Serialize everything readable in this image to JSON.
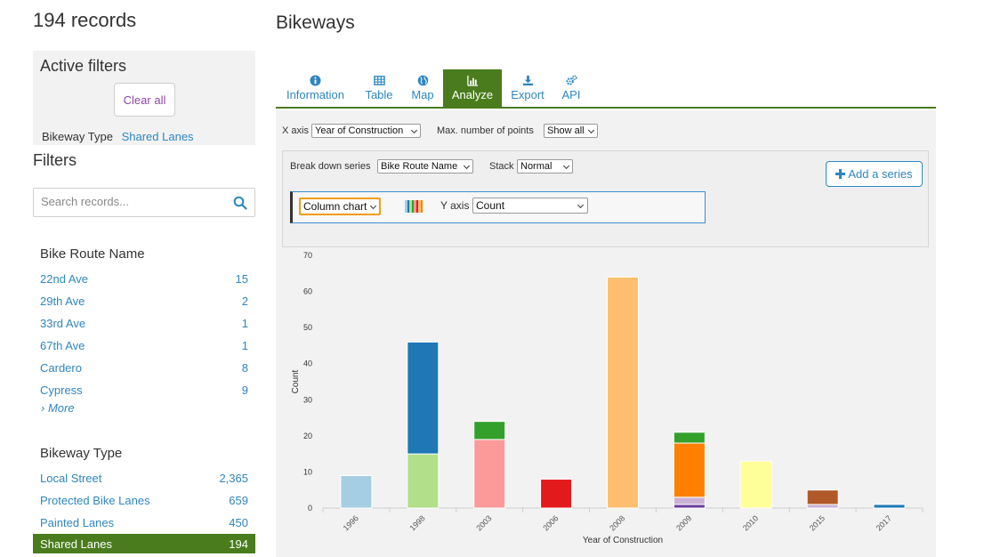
{
  "sidebar": {
    "records_count": "194 records",
    "active_filters": {
      "title": "Active filters",
      "clear_label": "Clear all",
      "filter_key": "Bikeway Type",
      "filter_value": "Shared Lanes"
    },
    "filters_title": "Filters",
    "search_placeholder": "Search records...",
    "bike_route": {
      "title": "Bike Route Name",
      "items": [
        {
          "label": "22nd Ave",
          "count": "15"
        },
        {
          "label": "29th Ave",
          "count": "2"
        },
        {
          "label": "33rd Ave",
          "count": "1"
        },
        {
          "label": "67th Ave",
          "count": "1"
        },
        {
          "label": "Cardero",
          "count": "8"
        },
        {
          "label": "Cypress",
          "count": "9"
        }
      ],
      "more_label": "› More"
    },
    "bikeway_type": {
      "title": "Bikeway Type",
      "items": [
        {
          "label": "Local Street",
          "count": "2,365"
        },
        {
          "label": "Protected Bike Lanes",
          "count": "659"
        },
        {
          "label": "Painted Lanes",
          "count": "450"
        },
        {
          "label": "Shared Lanes",
          "count": "194"
        }
      ]
    }
  },
  "main": {
    "title": "Bikeways",
    "tabs": [
      {
        "label": "Information",
        "icon": "info-icon"
      },
      {
        "label": "Table",
        "icon": "table-icon"
      },
      {
        "label": "Map",
        "icon": "globe-icon"
      },
      {
        "label": "Analyze",
        "icon": "bar-chart-icon"
      },
      {
        "label": "Export",
        "icon": "download-icon"
      },
      {
        "label": "API",
        "icon": "gears-icon"
      }
    ],
    "controls": {
      "x_axis_label": "X axis",
      "x_axis_value": "Year of Construction",
      "max_points_label": "Max. number of points",
      "max_points_value": "Show all",
      "breakdown_label": "Break down series",
      "breakdown_value": "Bike Route Name",
      "stack_label": "Stack",
      "stack_value": "Normal",
      "add_series_label": "Add a series",
      "chart_type_value": "Column chart",
      "y_axis_label": "Y axis",
      "y_axis_value": "Count"
    },
    "accent_color": "#4a7c1d",
    "link_color": "#2e86c1"
  },
  "chart_data": {
    "type": "bar",
    "stacked": true,
    "xlabel": "Year of Construction",
    "ylabel": "Count",
    "ylim": [
      0,
      70
    ],
    "yticks": [
      0,
      10,
      20,
      30,
      40,
      50,
      60,
      70
    ],
    "categories": [
      "1996",
      "1998",
      "2003",
      "2006",
      "2008",
      "2009",
      "2010",
      "2015",
      "2017"
    ],
    "stacks": [
      [
        {
          "value": 9,
          "color": "#a6cee3"
        }
      ],
      [
        {
          "value": 15,
          "color": "#b2df8a"
        },
        {
          "value": 31,
          "color": "#1f78b4"
        }
      ],
      [
        {
          "value": 19,
          "color": "#fb9a99"
        },
        {
          "value": 5,
          "color": "#33a02c"
        }
      ],
      [
        {
          "value": 8,
          "color": "#e31a1c"
        }
      ],
      [
        {
          "value": 64,
          "color": "#fdbf6f"
        }
      ],
      [
        {
          "value": 1,
          "color": "#6a3d9a"
        },
        {
          "value": 2,
          "color": "#cab2d6"
        },
        {
          "value": 15,
          "color": "#ff7f00"
        },
        {
          "value": 3,
          "color": "#33a02c"
        }
      ],
      [
        {
          "value": 13,
          "color": "#ffff99"
        }
      ],
      [
        {
          "value": 1,
          "color": "#cab2d6"
        },
        {
          "value": 4,
          "color": "#b15928"
        }
      ],
      [
        {
          "value": 1,
          "color": "#1f78b4"
        }
      ]
    ]
  }
}
